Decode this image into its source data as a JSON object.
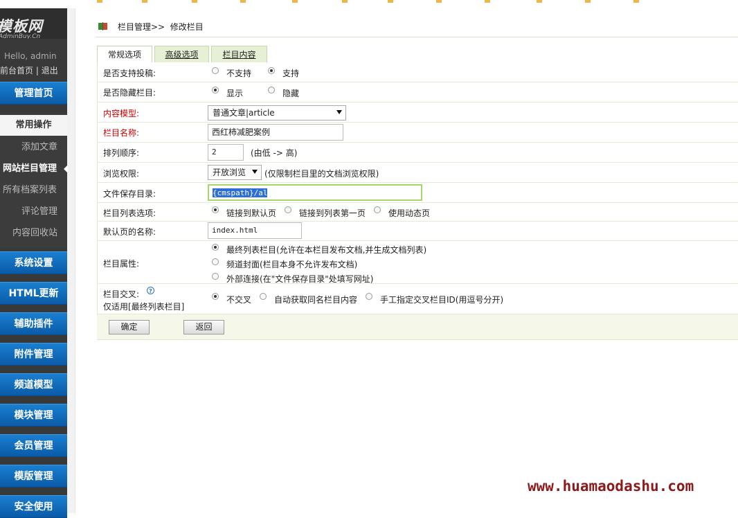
{
  "brand": {
    "title": "模板网",
    "subtitle": "AdminBuy.Cn"
  },
  "user": {
    "greeting": "Hello, admin",
    "home_link": "前台首页",
    "sep": "|",
    "logout": "退出"
  },
  "nav_top": "管理首页",
  "submenu": {
    "heading": "常用操作",
    "items": [
      {
        "label": "添加文章"
      },
      {
        "label": "网站栏目管理",
        "active": true
      },
      {
        "label": "所有档案列表"
      },
      {
        "label": "评论管理"
      },
      {
        "label": "内容回收站"
      }
    ]
  },
  "nav": [
    "系统设置",
    "HTML更新",
    "辅助插件",
    "附件管理",
    "频道模型",
    "模块管理",
    "会员管理",
    "模版管理",
    "安全使用"
  ],
  "breadcrumb": {
    "parent": "栏目管理>>",
    "current": "修改栏目"
  },
  "tabs": [
    "常规选项",
    "高级选项",
    "栏目内容"
  ],
  "form": {
    "submit": {
      "label": "是否支持投稿:",
      "options": [
        "不支持",
        "支持"
      ],
      "selected": 1
    },
    "hidden": {
      "label": "是否隐藏栏目:",
      "options": [
        "显示",
        "隐藏"
      ],
      "selected": 0
    },
    "model": {
      "label": "内容模型:",
      "value": "普通文章|article"
    },
    "name": {
      "label": "栏目名称:",
      "value": "西红柿减肥案例"
    },
    "order": {
      "label": "排列顺序:",
      "value": "2",
      "hint": "(由低 -> 高)"
    },
    "browse": {
      "label": "浏览权限:",
      "value": "开放浏览",
      "hint": "(仅限制栏目里的文档浏览权限)"
    },
    "dir": {
      "label": "文件保存目录:",
      "value": "{cmspath}/al"
    },
    "list_opt": {
      "label": "栏目列表选项:",
      "options": [
        "链接到默认页",
        "链接到列表第一页",
        "使用动态页"
      ],
      "selected": 0
    },
    "default_page": {
      "label": "默认页的名称:",
      "value": "index.html"
    },
    "attr": {
      "label": "栏目属性:",
      "options": [
        "最终列表栏目(允许在本栏目发布文档,并生成文档列表)",
        "频道封面(栏目本身不允许发布文档)",
        "外部连接(在\"文件保存目录\"处填写网址)"
      ],
      "selected": 0
    },
    "cross": {
      "label": "栏目交叉:",
      "label2": "仅适用[最终列表栏目]",
      "help": "?",
      "options": [
        "不交叉",
        "自动获取同名栏目内容",
        "手工指定交叉栏目ID(用逗号分开)"
      ],
      "selected": 0
    }
  },
  "buttons": {
    "ok": "确定",
    "back": "返回"
  },
  "watermark": "www.huamaodashu.com"
}
